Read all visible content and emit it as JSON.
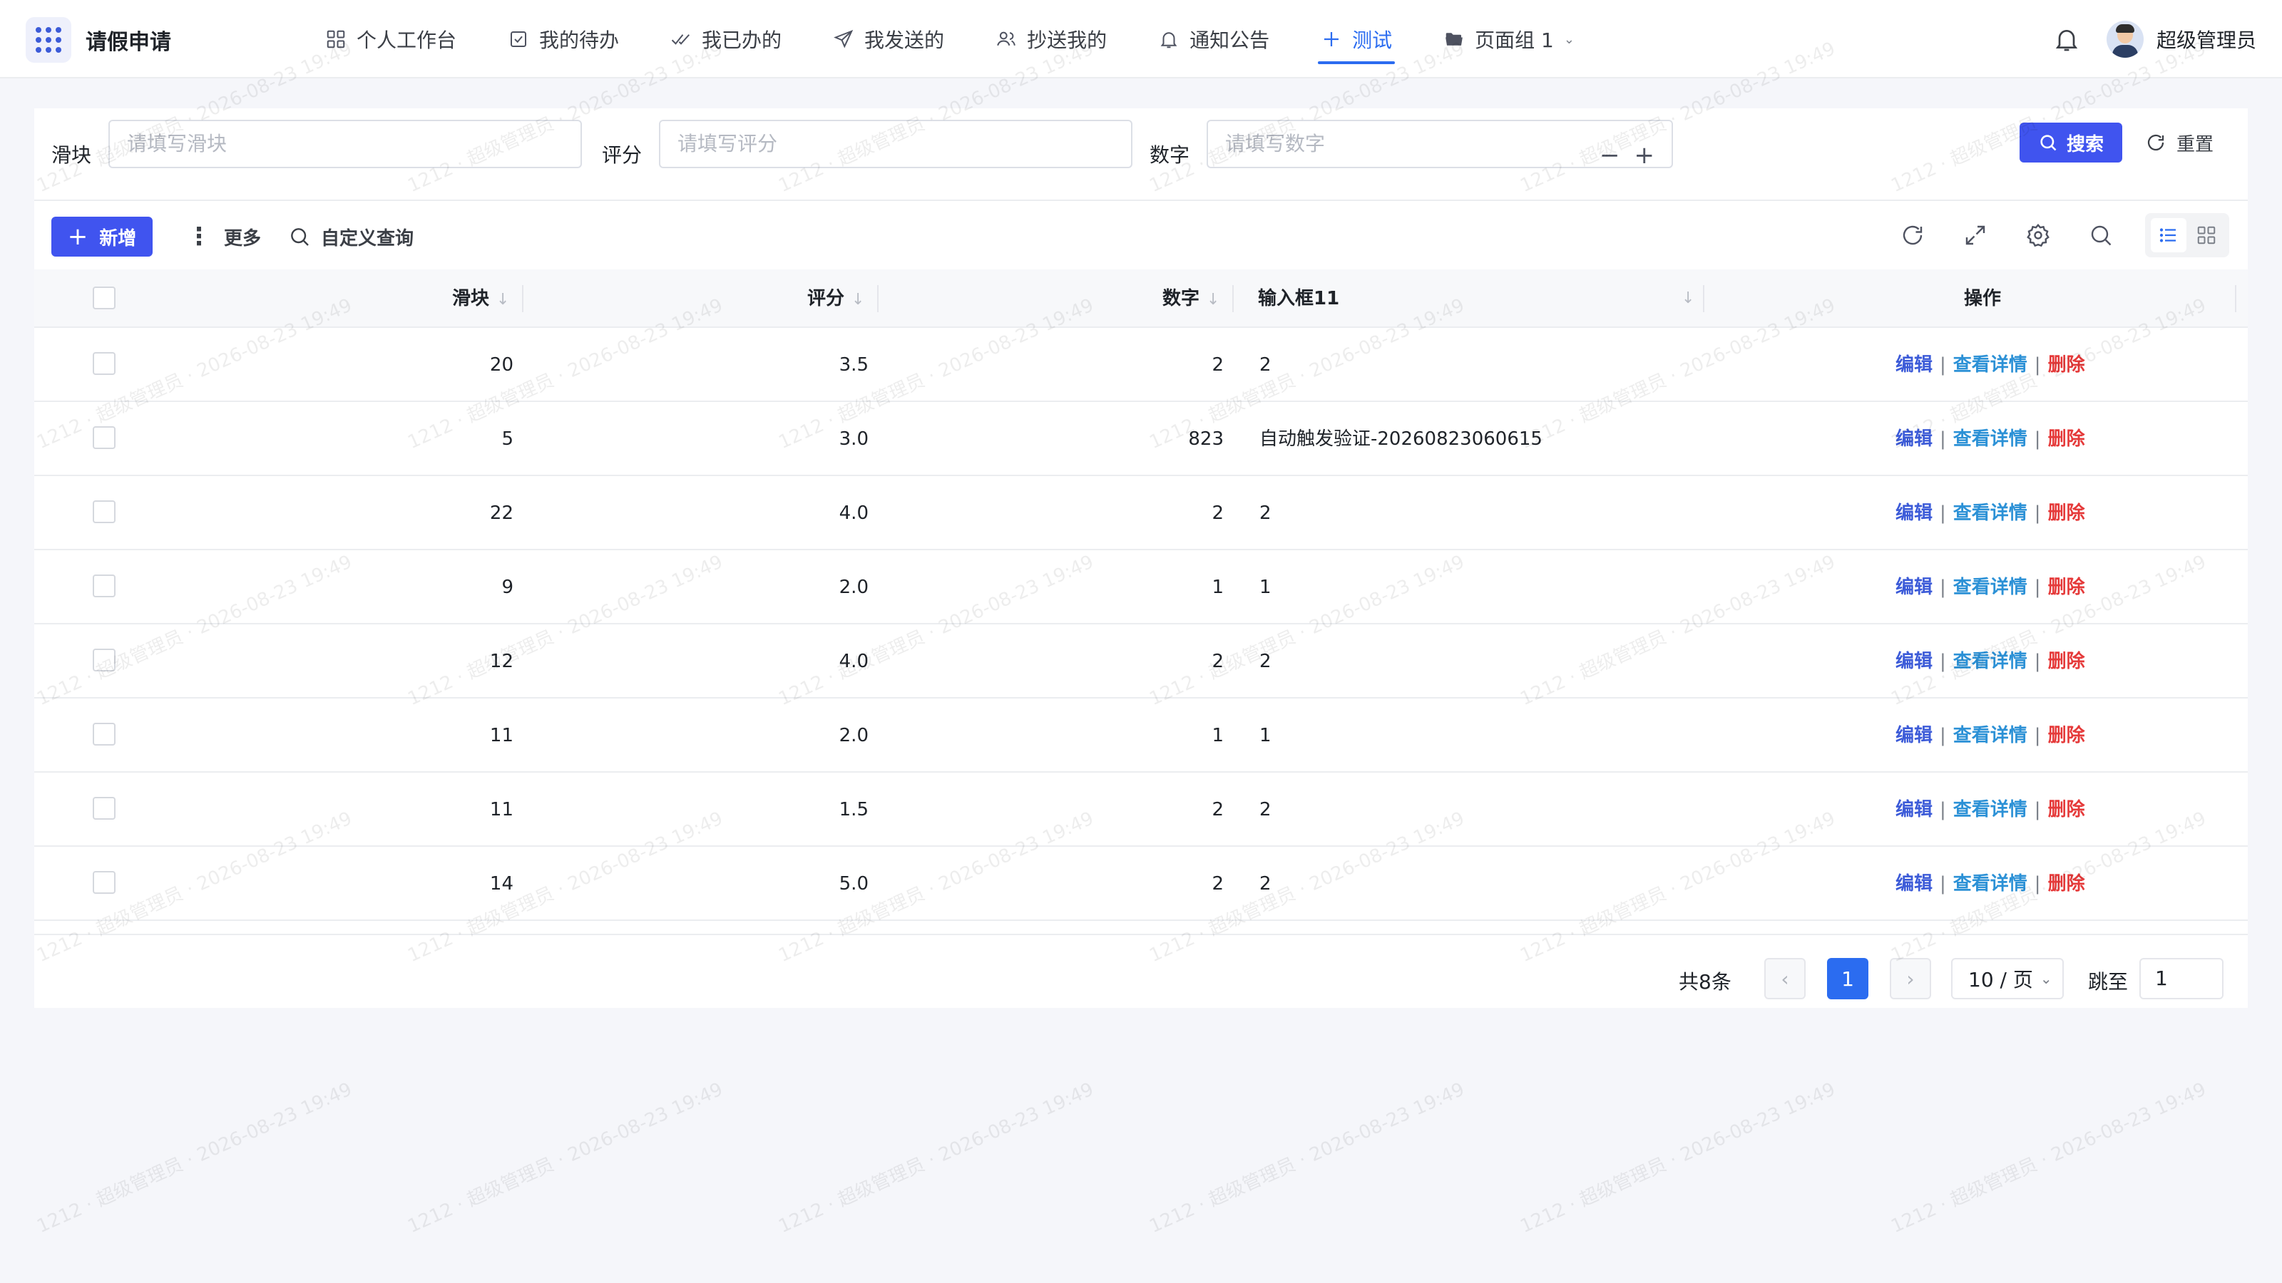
{
  "app": {
    "title": "请假申请"
  },
  "nav": {
    "items": [
      {
        "label": "个人工作台",
        "icon": "grid-icon"
      },
      {
        "label": "我的待办",
        "icon": "checkbox-icon"
      },
      {
        "label": "我已办的",
        "icon": "double-check-icon"
      },
      {
        "label": "我发送的",
        "icon": "send-icon"
      },
      {
        "label": "抄送我的",
        "icon": "users-icon"
      },
      {
        "label": "通知公告",
        "icon": "bell-icon"
      },
      {
        "label": "测试",
        "icon": "plus-icon",
        "active": true
      },
      {
        "label": "页面组 1",
        "icon": "folder-icon",
        "dropdown": true
      }
    ],
    "user": "超级管理员"
  },
  "filters": {
    "slider_label": "滑块",
    "slider_placeholder": "请填写滑块",
    "rating_label": "评分",
    "rating_placeholder": "请填写评分",
    "number_label": "数字",
    "number_placeholder": "请填写数字",
    "minus": "−",
    "plus": "+",
    "search_label": "搜索",
    "reset_label": "重置"
  },
  "toolbar": {
    "add_label": "新增",
    "more_label": "更多",
    "custom_query_label": "自定义查询"
  },
  "table": {
    "columns": [
      "滑块",
      "评分",
      "数字",
      "输入框11",
      "操作"
    ],
    "rows": [
      {
        "slider": "20",
        "rating": "3.5",
        "number": "2",
        "input": "2"
      },
      {
        "slider": "5",
        "rating": "3.0",
        "number": "823",
        "input": "自动触发验证-20260823060615"
      },
      {
        "slider": "22",
        "rating": "4.0",
        "number": "2",
        "input": "2"
      },
      {
        "slider": "9",
        "rating": "2.0",
        "number": "1",
        "input": "1"
      },
      {
        "slider": "12",
        "rating": "4.0",
        "number": "2",
        "input": "2"
      },
      {
        "slider": "11",
        "rating": "2.0",
        "number": "1",
        "input": "1"
      },
      {
        "slider": "11",
        "rating": "1.5",
        "number": "2",
        "input": "2"
      },
      {
        "slider": "14",
        "rating": "5.0",
        "number": "2",
        "input": "2"
      }
    ],
    "ops": {
      "edit": "编辑",
      "view": "查看详情",
      "delete": "删除",
      "sep": "|"
    }
  },
  "pagination": {
    "total": "共8条",
    "current_page": "1",
    "page_size": "10 / 页",
    "jump_label": "跳至",
    "jump_value": "1"
  },
  "watermark": "1212 · 超级管理员 · 2026-08-23 19:49",
  "colors": {
    "primary": "#4054ef",
    "link": "#3c5bd8",
    "danger": "#e53a3a",
    "active_nav": "#2b6cf0"
  }
}
